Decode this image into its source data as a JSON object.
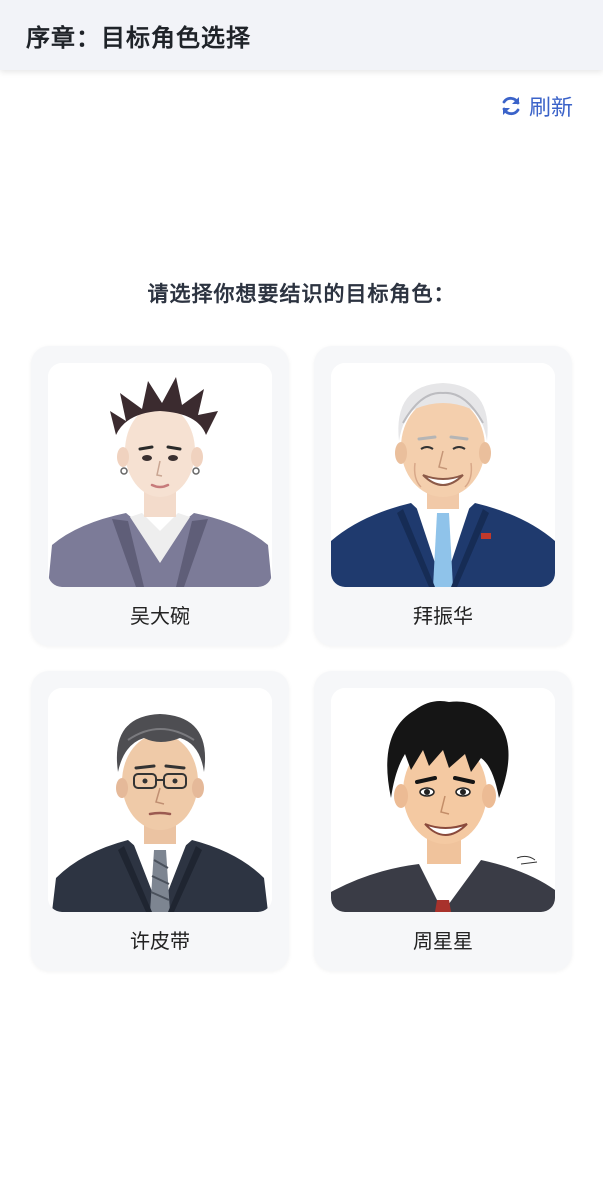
{
  "header": {
    "title": "序章：目标角色选择"
  },
  "refresh": {
    "label": "刷新",
    "icon": "refresh-icon"
  },
  "prompt": "请选择你想要结识的目标角色：",
  "characters": [
    {
      "name": "吴大碗"
    },
    {
      "name": "拜振华"
    },
    {
      "name": "许皮带"
    },
    {
      "name": "周星星"
    }
  ],
  "colors": {
    "accent": "#3b63c9"
  }
}
